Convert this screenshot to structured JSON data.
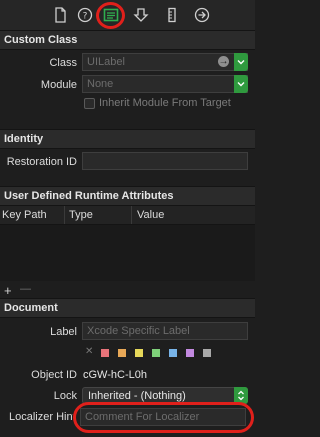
{
  "toolbar": {
    "icons": [
      "file-inspector-icon",
      "help-icon",
      "identity-inspector-icon",
      "attributes-inspector-icon",
      "size-inspector-icon",
      "connections-inspector-icon"
    ]
  },
  "custom_class": {
    "title": "Custom Class",
    "class_label": "Class",
    "class_placeholder": "UILabel",
    "module_label": "Module",
    "module_placeholder": "None",
    "inherit_label": "Inherit Module From Target"
  },
  "identity": {
    "title": "Identity",
    "restoration_label": "Restoration ID"
  },
  "runtime_attrs": {
    "title": "User Defined Runtime Attributes",
    "columns": [
      "Key Path",
      "Type",
      "Value"
    ],
    "add": "+",
    "remove": "—"
  },
  "document": {
    "title": "Document",
    "label_label": "Label",
    "label_placeholder": "Xcode Specific Label",
    "swatch_clear": "✕",
    "swatch_colors": [
      "#e8737a",
      "#e8a857",
      "#e6d85a",
      "#7fd17a",
      "#78b4e8",
      "#c38ae0",
      "#a9a9a9"
    ],
    "object_id_label": "Object ID",
    "object_id_value": "cGW-hC-L0h",
    "lock_label": "Lock",
    "lock_value": "Inherited - (Nothing)",
    "localizer_label": "Localizer Hint",
    "localizer_placeholder": "Comment For Localizer"
  }
}
